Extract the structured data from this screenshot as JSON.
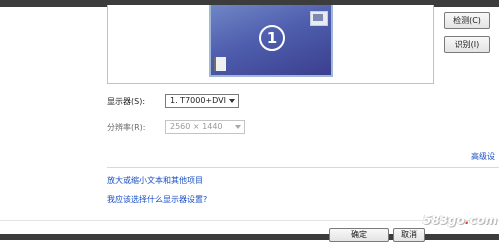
{
  "preview": {
    "monitor_number": "1"
  },
  "buttons": {
    "detect": "检测(C)",
    "identify": "识别(I)",
    "ok": "确定",
    "cancel": "取消"
  },
  "display": {
    "label": "显示器(S):",
    "value": "1. T7000+DVI"
  },
  "resolution": {
    "label": "分辨率(R):",
    "value": "2560 × 1440"
  },
  "links": {
    "advanced": "高级设",
    "text_size": "放大或缩小文本和其他项目",
    "which_settings": "我应该选择什么显示器设置?"
  },
  "watermark": {
    "prefix": "583go",
    "accent": "."
  },
  "colors": {
    "monitor_fill": "#4f5eae",
    "link": "#1a4fc4",
    "watermark_accent": "#e23a2f"
  },
  "icons": {
    "window": "window-icon",
    "taskbar": "taskbar-icon",
    "dropdown": "chevron-down-icon"
  }
}
